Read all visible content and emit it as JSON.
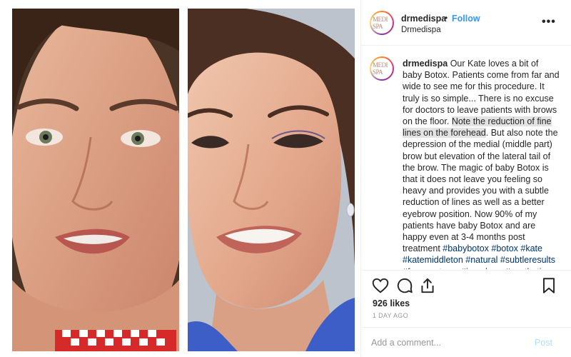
{
  "post": {
    "username": "drmedispa",
    "separator": "•",
    "follow_label": "Follow",
    "subtitle": "Drmedispa",
    "more_label": "•••",
    "avatar_logo": "MEDI SPA"
  },
  "caption": {
    "username": "drmedispa",
    "part1": " Our Kate loves a bit of baby Botox. Patients come from far and wide to see me for this procedure. It truly is so simple... There is no excuse for doctors to leave patients with brows on the floor. ",
    "highlight": "Note the reduction of fine lines on the forehead",
    "part2": ". But also note the depression of the medial (middle part) brow but elevation of the lateral tail of the brow. The magic of baby Botox is that it does not leave you feeling so heavy and provides you with a subtle reduction of lines as well as a better eyebrow position. Now 90% of my patients have baby Botox and are happy even at 3-4 months post treatment ",
    "hashtags": "#babybotox #botox #kate #katemiddleton #natural #subtleresults #faceanatomy #juvederm #aesthetics #cosmeticsurgery #plasticsurgery"
  },
  "actions": {
    "icons": [
      "heart-icon",
      "comment-icon",
      "share-icon",
      "bookmark-icon"
    ]
  },
  "likes": "926 likes",
  "time": "1 DAY AGO",
  "comment": {
    "placeholder": "Add a comment...",
    "post_label": "Post"
  },
  "colors": {
    "follow": "#3897f0",
    "hashtag": "#003569",
    "post_disabled": "#b2dffc",
    "muted": "#999999",
    "highlight": "#e3e3e3"
  },
  "media": {
    "description_left": "before-photo",
    "description_right": "after-photo"
  }
}
